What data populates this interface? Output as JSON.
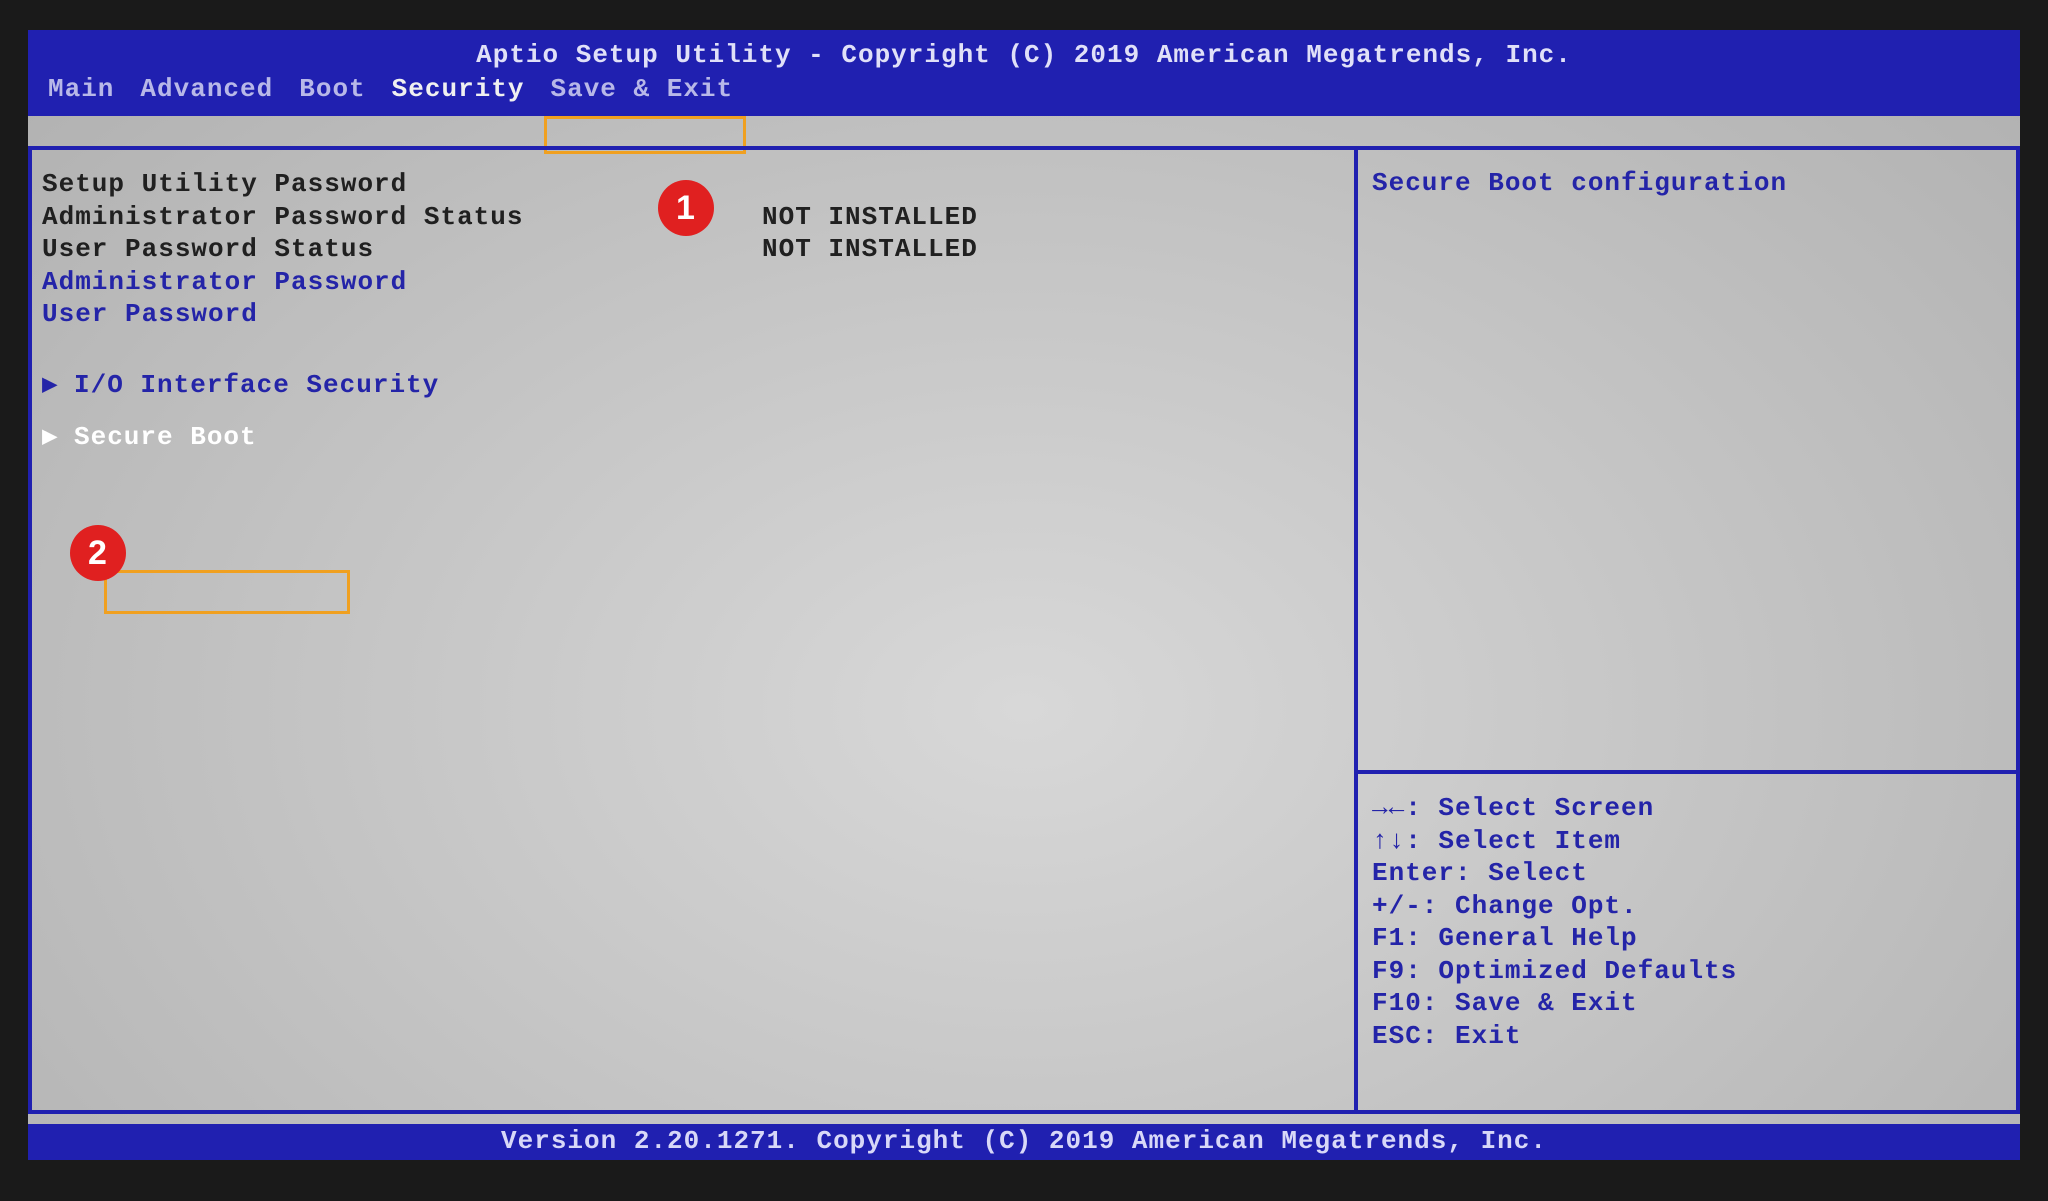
{
  "header": {
    "title": "Aptio Setup Utility - Copyright (C) 2019 American Megatrends, Inc."
  },
  "tabs": [
    {
      "label": "Main"
    },
    {
      "label": "Advanced"
    },
    {
      "label": "Boot"
    },
    {
      "label": "Security"
    },
    {
      "label": "Save & Exit"
    }
  ],
  "main": {
    "heading": "Setup Utility Password",
    "rows": [
      {
        "label": "Administrator Password Status",
        "value": "NOT INSTALLED"
      },
      {
        "label": "User Password Status",
        "value": "NOT INSTALLED"
      }
    ],
    "links": [
      {
        "label": "Administrator Password"
      },
      {
        "label": "User Password"
      }
    ],
    "submenus": [
      {
        "label": "I/O Interface Security"
      },
      {
        "label": "Secure Boot"
      }
    ]
  },
  "help": {
    "description": "Secure Boot configuration",
    "keys": [
      "→←: Select Screen",
      "↑↓: Select Item",
      "Enter: Select",
      "+/-: Change Opt.",
      "F1: General Help",
      "F9: Optimized Defaults",
      "F10: Save & Exit",
      "ESC: Exit"
    ]
  },
  "footer": {
    "text": "Version 2.20.1271. Copyright (C) 2019 American Megatrends, Inc."
  },
  "callouts": {
    "one": "1",
    "two": "2"
  }
}
